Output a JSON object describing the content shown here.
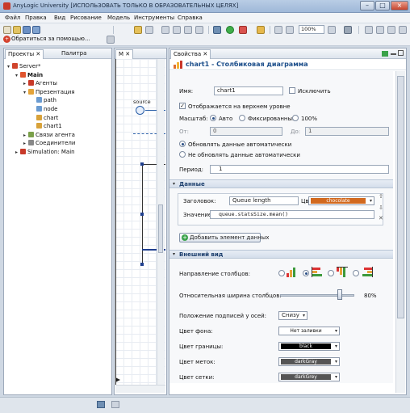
{
  "window": {
    "title": "AnyLogic University [ИСПОЛЬЗОВАТЬ ТОЛЬКО В ОБРАЗОВАТЕЛЬНЫХ ЦЕЛЯХ]",
    "minimize": "–",
    "maximize": "□",
    "close": "×"
  },
  "menu": [
    "Файл",
    "Правка",
    "Вид",
    "Рисование",
    "Модель",
    "Инструменты",
    "Справка"
  ],
  "toolbar": {
    "zoom_value": "100%",
    "help_label": "Обратиться за помощью..."
  },
  "projects_pane": {
    "tab_projects": "Проекты",
    "tab_palette": "Палитра",
    "tree": [
      {
        "label": "Server*",
        "level": 0,
        "bold": false,
        "icon_color": "#d0442c",
        "twisty": "▾"
      },
      {
        "label": "Main",
        "level": 1,
        "bold": true,
        "icon_color": "#e0552f",
        "twisty": "▾"
      },
      {
        "label": "Агенты",
        "level": 2,
        "bold": false,
        "icon_color": "#c83a2a",
        "twisty": "▸"
      },
      {
        "label": "Презентация",
        "level": 2,
        "bold": false,
        "icon_color": "#e3a33a",
        "twisty": "▾"
      },
      {
        "label": "path",
        "level": 3,
        "bold": false,
        "icon_color": "#6a9bd1",
        "twisty": ""
      },
      {
        "label": "node",
        "level": 3,
        "bold": false,
        "icon_color": "#6a9bd1",
        "twisty": ""
      },
      {
        "label": "chart",
        "level": 3,
        "bold": false,
        "icon_color": "#d8a23a",
        "twisty": ""
      },
      {
        "label": "chart1",
        "level": 3,
        "bold": false,
        "icon_color": "#d8a23a",
        "twisty": ""
      },
      {
        "label": "Связи агента",
        "level": 2,
        "bold": false,
        "icon_color": "#7aa04a",
        "twisty": "▸"
      },
      {
        "label": "Соединители",
        "level": 2,
        "bold": false,
        "icon_color": "#888888",
        "twisty": "▸"
      },
      {
        "label": "Simulation: Main",
        "level": 1,
        "bold": false,
        "icon_color": "#c83a2a",
        "twisty": "▸"
      }
    ]
  },
  "editor_pane": {
    "tab": "M",
    "source_label": "source"
  },
  "properties_pane": {
    "tab": "Свойства",
    "title": "chart1 - Столбиковая диаграмма",
    "name_label": "Имя:",
    "name_value": "chart1",
    "exclude_label": "Исключить",
    "show_on_top_label": "Отображается на верхнем уровне",
    "scale_label": "Масштаб:",
    "scale_auto": "Авто",
    "scale_fixed": "Фиксированный",
    "scale_100": "100%",
    "from_label": "От:",
    "from_value": "0",
    "to_label": "До:",
    "to_value": "1",
    "update_auto": "Обновлять данные автоматически",
    "update_manual": "Не обновлять данные автоматически",
    "period_label": "Период:",
    "period_value": "1",
    "data_section": "Данные",
    "title_label": "Заголовок:",
    "title_value": "Queue length",
    "color_label": "Цвет:",
    "color_value": "chocolate",
    "value_label": "Значение:",
    "value_value": "queue.statsSize.mean()",
    "add_data_button": "Добавить элемент данных",
    "appearance_section": "Внешний вид",
    "bar_direction_label": "Направление столбцов:",
    "bar_width_label": "Относительная ширина столбцов:",
    "bar_width_value": "80%",
    "bar_width_fraction": 0.8,
    "axis_labels_pos_label": "Положение подписей у осей:",
    "axis_labels_pos_value": "Снизу",
    "bg_color_label": "Цвет фона:",
    "bg_color_value": "Нет заливки",
    "border_color_label": "Цвет границы:",
    "border_color_value": "black",
    "tick_color_label": "Цвет меток:",
    "tick_color_value": "darkGray",
    "grid_color_label": "Цвет сетки:",
    "grid_color_value": "darkGrey"
  },
  "colors": {
    "chocolate": "#d2691e",
    "black": "#000000",
    "darkGray": "#555555"
  }
}
